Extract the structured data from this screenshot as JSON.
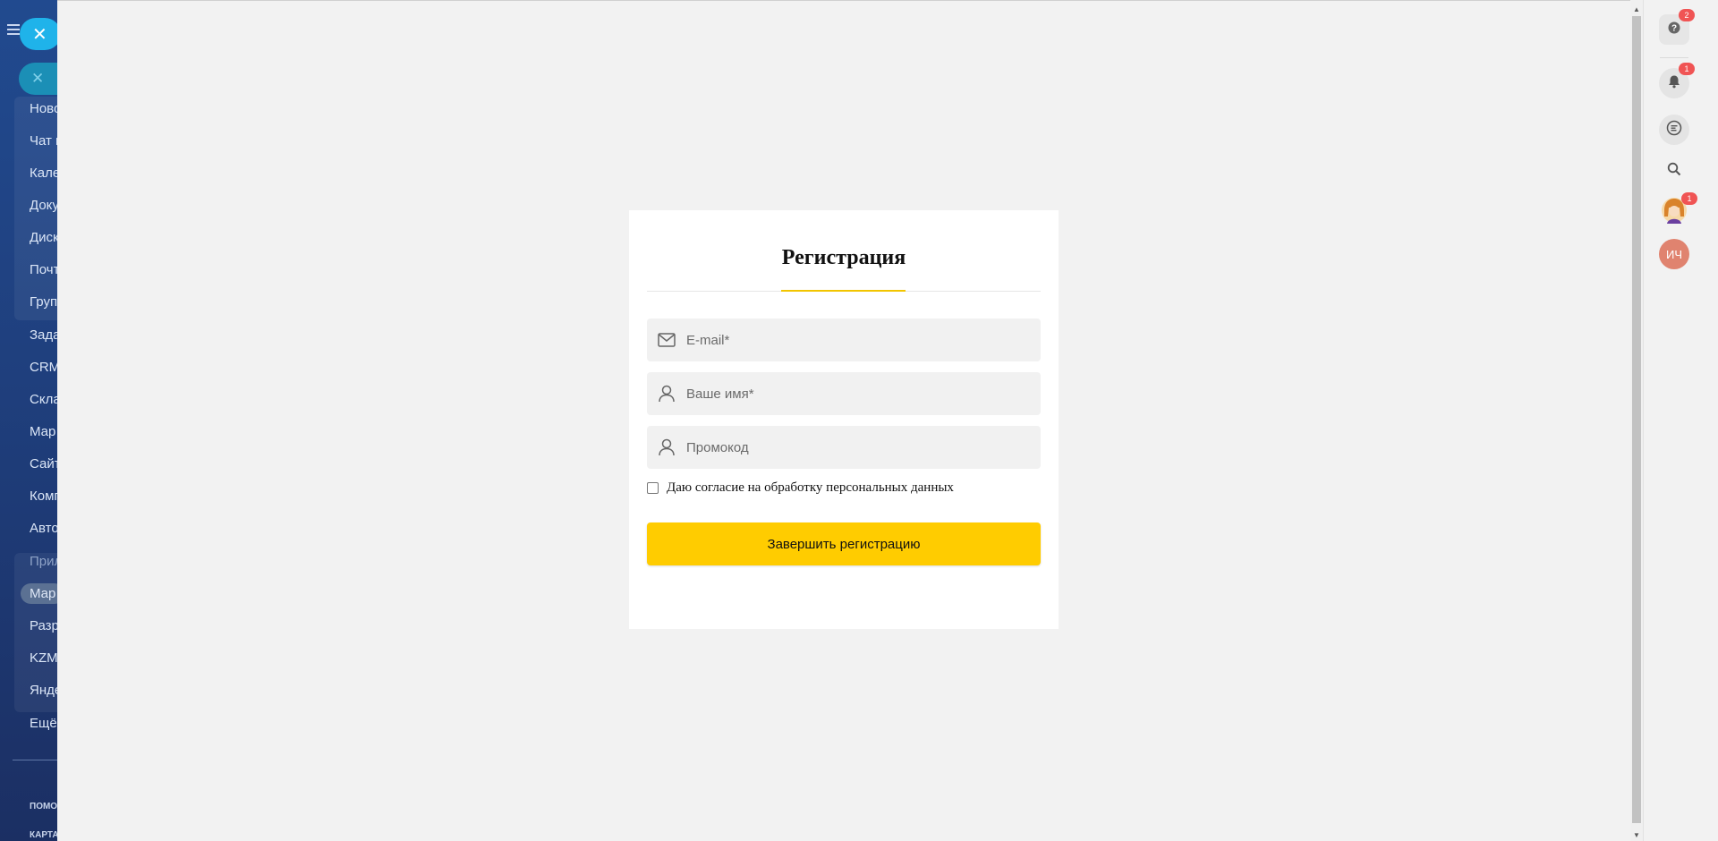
{
  "sidebar": {
    "close_icon": "✕",
    "search_close_icon": "✕",
    "items": [
      {
        "label": "Ново"
      },
      {
        "label": "Чат и"
      },
      {
        "label": "Кале"
      },
      {
        "label": "Доку"
      },
      {
        "label": "Диск"
      },
      {
        "label": "Почт"
      },
      {
        "label": "Груп"
      },
      {
        "label": "Зада"
      },
      {
        "label": "CRM"
      },
      {
        "label": "Скла"
      },
      {
        "label": "Мар"
      },
      {
        "label": "Сайт"
      },
      {
        "label": "Комп"
      },
      {
        "label": "Авто"
      },
      {
        "label": "Прил"
      },
      {
        "label": "Мар"
      },
      {
        "label": "Разр"
      },
      {
        "label": "KZM"
      },
      {
        "label": "Янде"
      },
      {
        "label": "Ещё"
      }
    ],
    "footer_items": [
      {
        "label": "ПОМО"
      },
      {
        "label": "КАРТА"
      }
    ]
  },
  "form": {
    "title": "Регистрация",
    "email_placeholder": "E-mail*",
    "name_placeholder": "Ваше имя*",
    "promo_placeholder": "Промокод",
    "consent_label": "Даю согласие на обработку персональных данных",
    "consent_checked": false,
    "submit_label": "Завершить регистрацию"
  },
  "right_panel": {
    "help_badge": "2",
    "notifications_badge": "1",
    "avatar_badge": "1",
    "user_initials": "ИЧ"
  },
  "colors": {
    "accent": "#ffcc00",
    "badge": "#f05454",
    "initials_avatar": "#e0836f"
  }
}
